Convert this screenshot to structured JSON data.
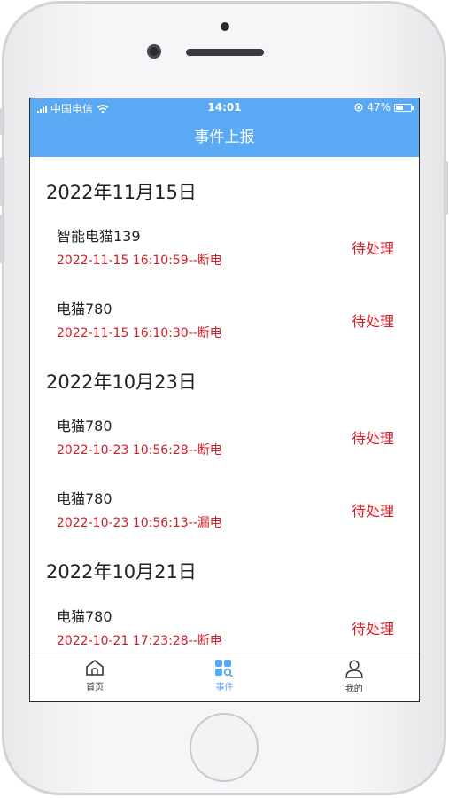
{
  "status_bar": {
    "carrier": "中国电信",
    "time": "14:01",
    "battery": "47%",
    "battery_level": 0.47
  },
  "header": {
    "title": "事件上报"
  },
  "groups": [
    {
      "date": "2022年11月15日",
      "events": [
        {
          "name": "智能电猫139",
          "detail": "2022-11-15 16:10:59--断电",
          "status": "待处理"
        },
        {
          "name": "电猫780",
          "detail": "2022-11-15 16:10:30--断电",
          "status": "待处理"
        }
      ]
    },
    {
      "date": "2022年10月23日",
      "events": [
        {
          "name": "电猫780",
          "detail": "2022-10-23 10:56:28--断电",
          "status": "待处理"
        },
        {
          "name": "电猫780",
          "detail": "2022-10-23 10:56:13--漏电",
          "status": "待处理"
        }
      ]
    },
    {
      "date": "2022年10月21日",
      "events": [
        {
          "name": "电猫780",
          "detail": "2022-10-21 17:23:28--断电",
          "status": "待处理"
        }
      ]
    }
  ],
  "tab_bar": {
    "items": [
      {
        "label": "首页",
        "icon": "home-icon"
      },
      {
        "label": "事件",
        "icon": "events-icon"
      },
      {
        "label": "我的",
        "icon": "profile-icon"
      }
    ],
    "active_index": 1
  },
  "colors": {
    "accent": "#5aa9f4",
    "alert": "#d0202a"
  }
}
